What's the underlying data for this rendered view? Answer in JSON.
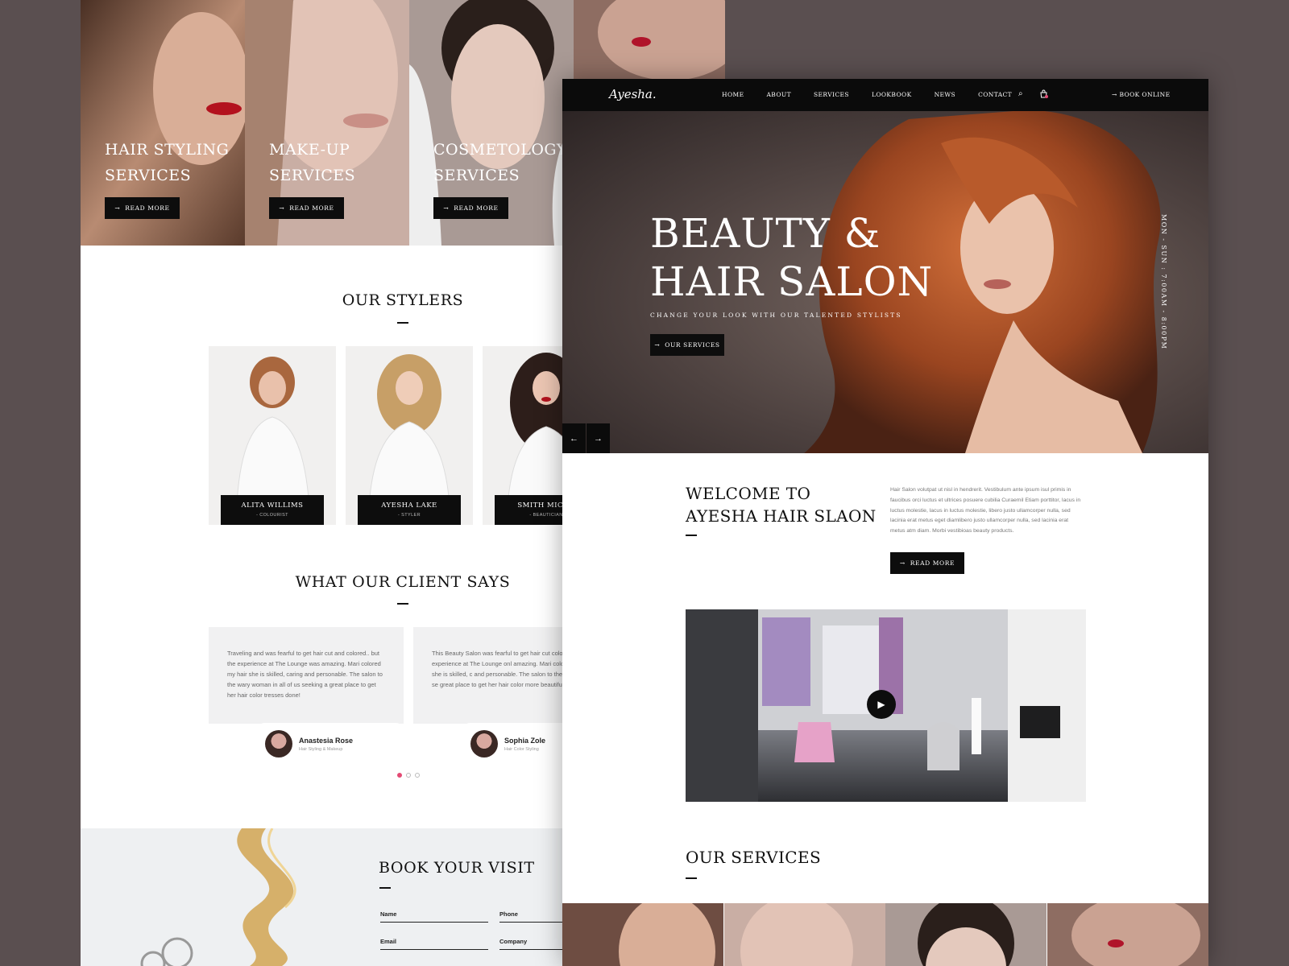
{
  "colors": {
    "background": "#5a4f50",
    "dark": "#0b0b0b",
    "accent": "#e44a74"
  },
  "back_page": {
    "service_cards": [
      {
        "line1": "HAIR STYLING",
        "line2": "SERVICES",
        "button": "READ MORE"
      },
      {
        "line1": "MAKE-UP",
        "line2": "SERVICES",
        "button": "READ MORE"
      },
      {
        "line1": "COSMETOLOGY",
        "line2": "SERVICES",
        "button": "READ MORE"
      }
    ],
    "stylers_title": "OUR STYLERS",
    "stylers": [
      {
        "name": "ALITA WILLIMS",
        "role": "- COLOURIST"
      },
      {
        "name": "AYESHA LAKE",
        "role": "- STYLER"
      },
      {
        "name": "SMITH MICHE",
        "role": "- BEAUTICIAN"
      }
    ],
    "testimonials_title": "WHAT OUR CLIENT SAYS",
    "testimonials": [
      {
        "text": "Traveling and was fearful to get hair cut and colored.. but the experience at The Lounge was amazing. Mari colored my hair she is skilled, caring and personable. The salon to the wary woman in all of us seeking a great place to get her hair color tresses done!",
        "name": "Anastesia Rose",
        "role": "Hair Styling & Makeup"
      },
      {
        "text": "This Beauty Salon was fearful to get hair cut colored.. but the experience at The Lounge onl amazing. Mari colored my hair she is skilled, c and personable. The salon to the in all of us se great place to get her hair color more beautifu",
        "name": "Sophia Zole",
        "role": "Hair Color Styling"
      }
    ],
    "booking": {
      "title": "BOOK YOUR VISIT",
      "fields": [
        "Name",
        "Phone",
        "Email",
        "Company"
      ]
    }
  },
  "front_page": {
    "logo": "Ayesha.",
    "nav": [
      "HOME",
      "ABOUT",
      "SERVICES",
      "LOOKBOOK",
      "NEWS",
      "CONTACT"
    ],
    "book_online": "BOOK ONLINE",
    "hero": {
      "title_line1": "BEAUTY &",
      "title_line2": "HAIR SALON",
      "subtitle": "CHANGE YOUR LOOK WITH OUR TALENTED STYLISTS",
      "button": "OUR SERVICES",
      "hours": "MON - SUN : 7:00AM - 8:00PM"
    },
    "welcome": {
      "line1": "WELCOME TO",
      "line2": "AYESHA HAIR SLAON",
      "text": "Hair Salon volutpat ut nisl in hendrerit. Vestibulum ante ipsum isul primis in faucibus orci luctus et ultrices posuere cubilia Curaemil Etiam porttitor, lacus in luctus molestie, lacus in luctus molestie, libero justo ullamcorper nulla, sed lacinia erat metus eget diamlibero justo ullamcorper nulla, sed lacinia erat metus atm diam. Morbi vestibioas beauty products.",
      "button": "READ MORE"
    },
    "services_title": "OUR SERVICES"
  },
  "icons": {
    "arrow_button": "→",
    "prev": "←",
    "next": "→",
    "search": "⌕",
    "cart": "🛍",
    "play": "▶"
  }
}
